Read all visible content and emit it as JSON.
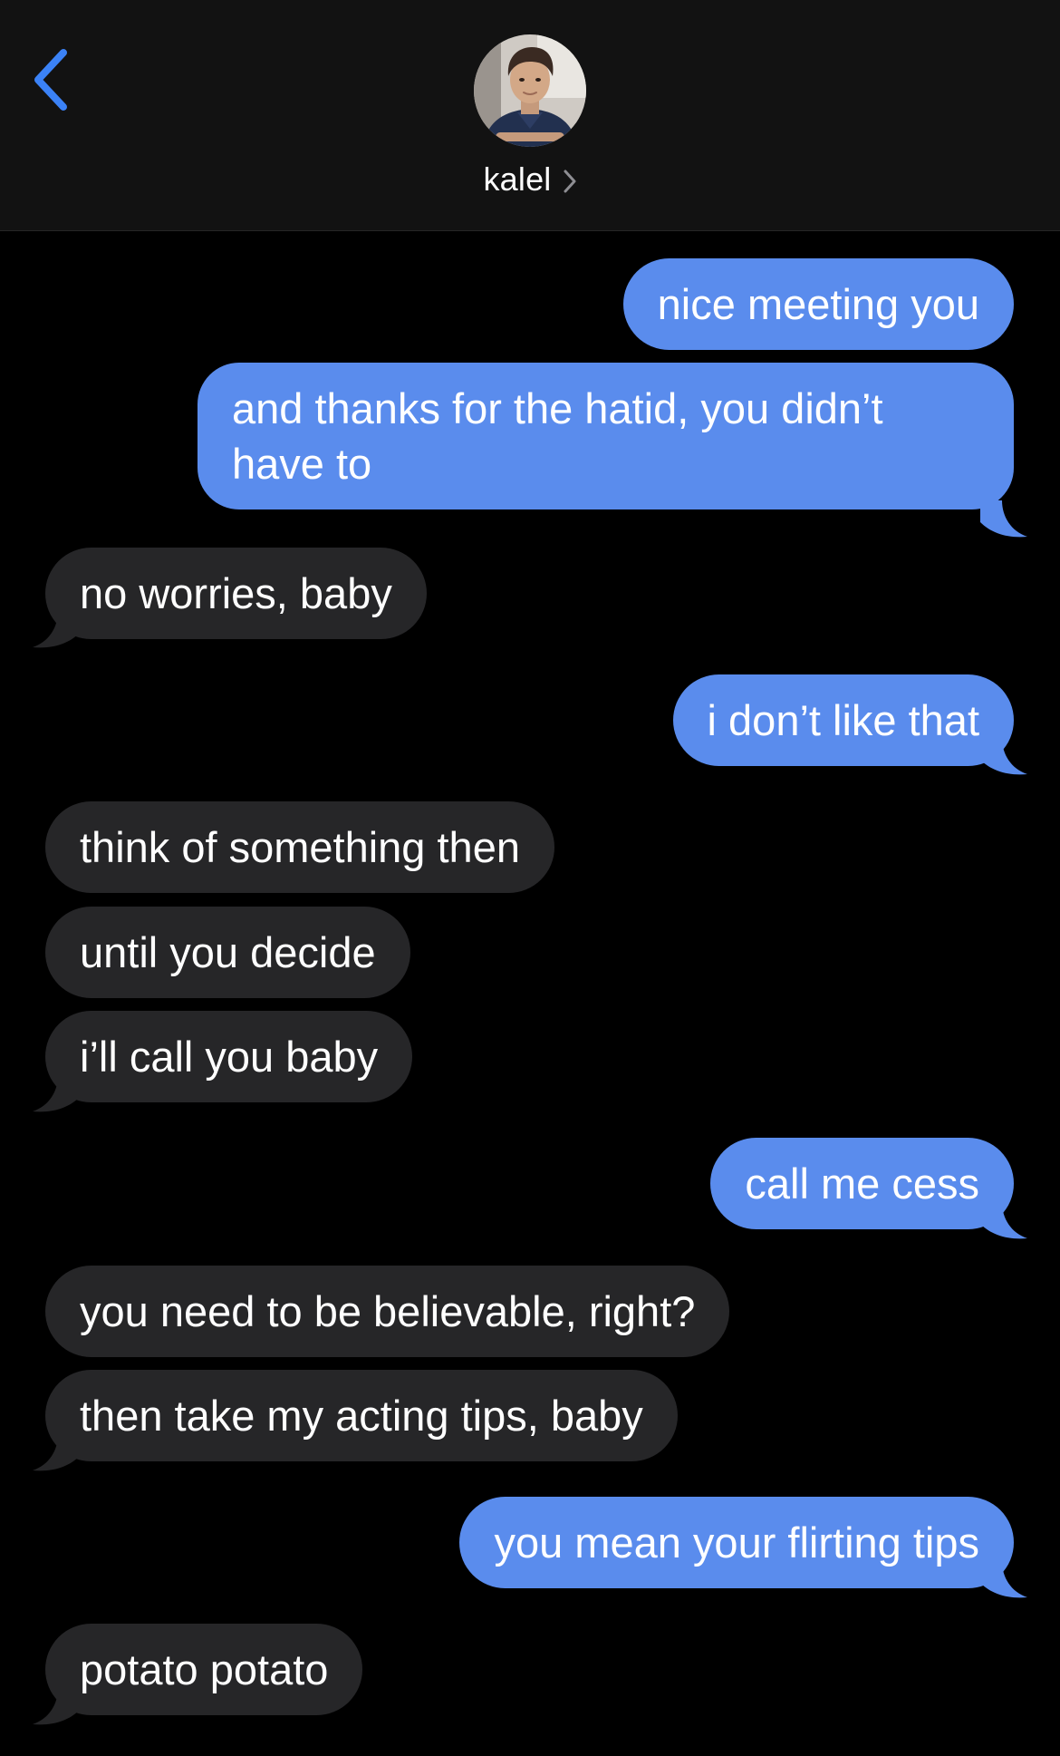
{
  "header": {
    "contact_name": "kalel",
    "back_icon": "chevron-left-icon",
    "disclosure_icon": "chevron-right-icon"
  },
  "colors": {
    "outgoing_bubble": "#5a8ced",
    "incoming_bubble": "#262628",
    "accent": "#3b82f6",
    "background": "#000000",
    "header_background": "#121212"
  },
  "messages": [
    {
      "direction": "outgoing",
      "text": "nice meeting you"
    },
    {
      "direction": "outgoing",
      "text": "and thanks for the hatid, you didn’t have to"
    },
    {
      "direction": "incoming",
      "text": "no worries, baby"
    },
    {
      "direction": "outgoing",
      "text": "i don’t like that"
    },
    {
      "direction": "incoming",
      "text": "think of something then"
    },
    {
      "direction": "incoming",
      "text": "until you decide"
    },
    {
      "direction": "incoming",
      "text": "i’ll call you baby"
    },
    {
      "direction": "outgoing",
      "text": "call me cess"
    },
    {
      "direction": "incoming",
      "text": "you need to be believable, right?"
    },
    {
      "direction": "incoming",
      "text": "then take my acting tips, baby"
    },
    {
      "direction": "outgoing",
      "text": "you mean your flirting tips"
    },
    {
      "direction": "incoming",
      "text": "potato potato"
    }
  ]
}
